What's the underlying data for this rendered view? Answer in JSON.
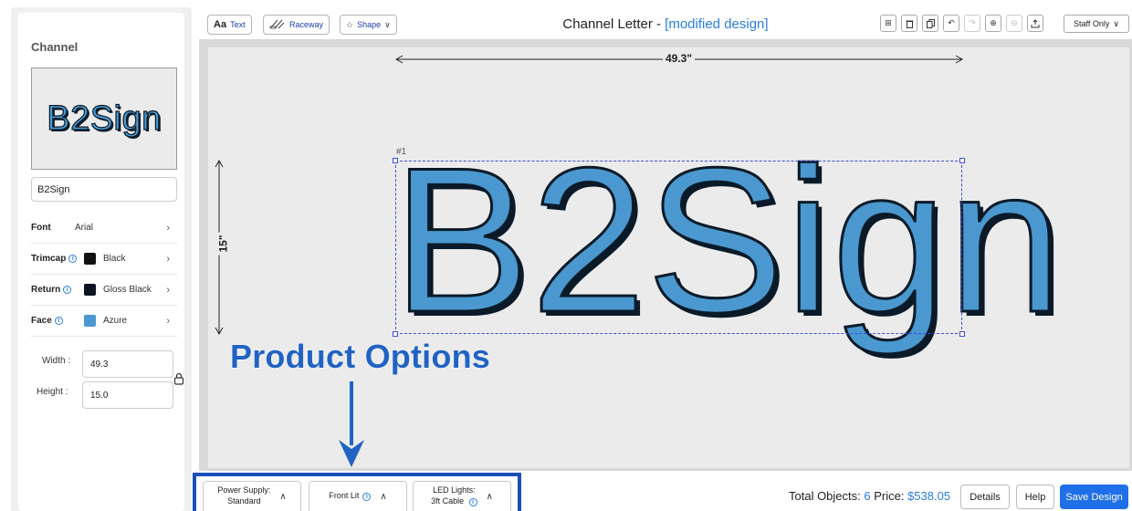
{
  "sidebar": {
    "title": "Channel",
    "preview_text": "B2Sign",
    "text_value": "B2Sign",
    "options": [
      {
        "label": "Font",
        "value": "Arial",
        "info": false,
        "swatch": null
      },
      {
        "label": "Trimcap",
        "value": "Black",
        "info": true,
        "swatch": "#111111"
      },
      {
        "label": "Return",
        "value": "Gloss Black",
        "info": true,
        "swatch": "#0b1420"
      },
      {
        "label": "Face",
        "value": "Azure",
        "info": true,
        "swatch": "#4a98cf"
      }
    ],
    "width_label": "Width :",
    "width_value": "49.3",
    "height_label": "Height :",
    "height_value": "15.0"
  },
  "toolbar": {
    "text_btn_icon": "Aa",
    "text_btn_label": "Text",
    "raceway_label": "Raceway",
    "shape_label": "Shape",
    "title_main": "Channel Letter - ",
    "title_status": "[modified design]",
    "icons": [
      "grid-icon",
      "delete-icon",
      "copy-icon",
      "undo-icon",
      "redo-icon",
      "zoom-in-icon",
      "zoom-out-icon",
      "export-icon"
    ],
    "staff_label": "Staff Only"
  },
  "canvas": {
    "width_dim": "49.3\"",
    "height_dim": "15\"",
    "object_number": "#1",
    "sign_text": "B2Sign",
    "annotation": "Product Options"
  },
  "bottom": {
    "power_supply_line1": "Power Supply:",
    "power_supply_line2": "Standard",
    "front_lit": "Front Lit",
    "led_line1": "LED Lights:",
    "led_line2": "3ft Cable",
    "total_label": "Total Objects: ",
    "total_value": "6",
    "price_label": " Price: ",
    "price_value": "$538.05",
    "details_label": "Details",
    "help_label": "Help",
    "save_label": "Save Design"
  },
  "colors": {
    "accent": "#2a7de1",
    "save_button": "#1f6fe8",
    "annotation": "#2163c2",
    "sign_face": "#4a98cf",
    "sign_outline": "#0b1a28"
  }
}
